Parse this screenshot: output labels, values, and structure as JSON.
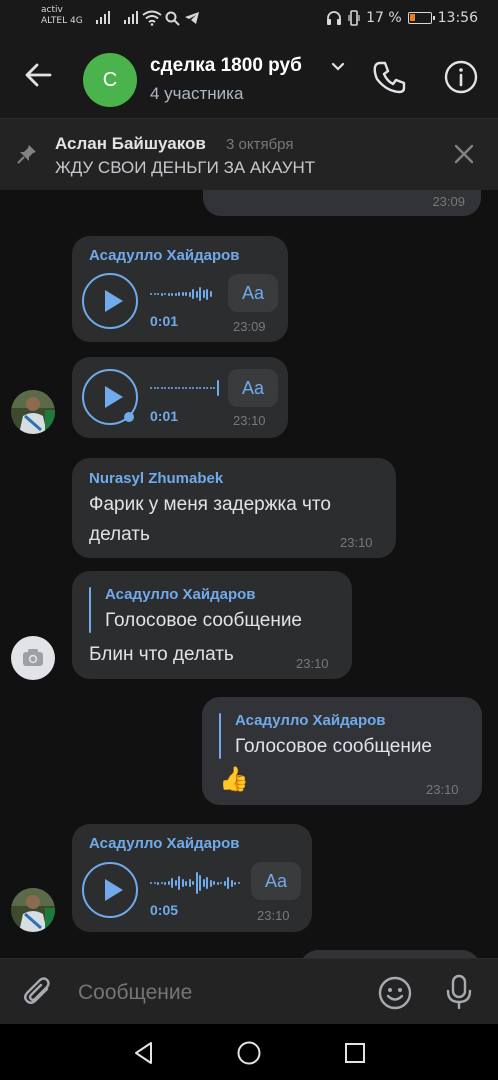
{
  "status_bar": {
    "carrier_line1": "activ",
    "carrier_line2": "ALTEL 4G",
    "battery_percent": "17 %",
    "battery_level": 0.17,
    "time": "13:56"
  },
  "header": {
    "chat_avatar_letter": "С",
    "chat_title": "сделка 1800 руб",
    "chat_subtitle": "4 участника",
    "avatar_color": "#4bb34b"
  },
  "pinned": {
    "author": "Аслан Байшуаков",
    "date": "3 октября",
    "text": "ЖДУ СВОИ ДЕНЬГИ ЗА АКАУНТ"
  },
  "messages": [
    {
      "type": "partial-outgoing",
      "emoji": "🤣🤣",
      "time": "23:09"
    },
    {
      "type": "voice",
      "sender": "Асадулло Хайдаров",
      "duration": "0:01",
      "aa": "Aa",
      "time": "23:09"
    },
    {
      "type": "voice",
      "duration": "0:01",
      "aa": "Aa",
      "time": "23:10",
      "unplayed": true
    },
    {
      "type": "text",
      "sender": "Nurasyl Zhumabek",
      "line1": "Фарик у меня задержка что",
      "line2": "делать",
      "time": "23:10"
    },
    {
      "type": "reply",
      "quote_author": "Асадулло Хайдаров",
      "quote_text": "Голосовое сообщение",
      "text": "Блин что делать",
      "time": "23:10"
    },
    {
      "type": "reply-outgoing",
      "quote_author": "Асадулло Хайдаров",
      "quote_text": "Голосовое сообщение",
      "emoji": "👍",
      "time": "23:10"
    },
    {
      "type": "voice",
      "sender": "Асадулло Хайдаров",
      "duration": "0:05",
      "aa": "Aa",
      "time": "23:10"
    }
  ],
  "composer": {
    "placeholder": "Сообщение"
  },
  "colors": {
    "accent": "#71aaeb",
    "background": "#111112",
    "bubble": "#2c2d2e"
  }
}
